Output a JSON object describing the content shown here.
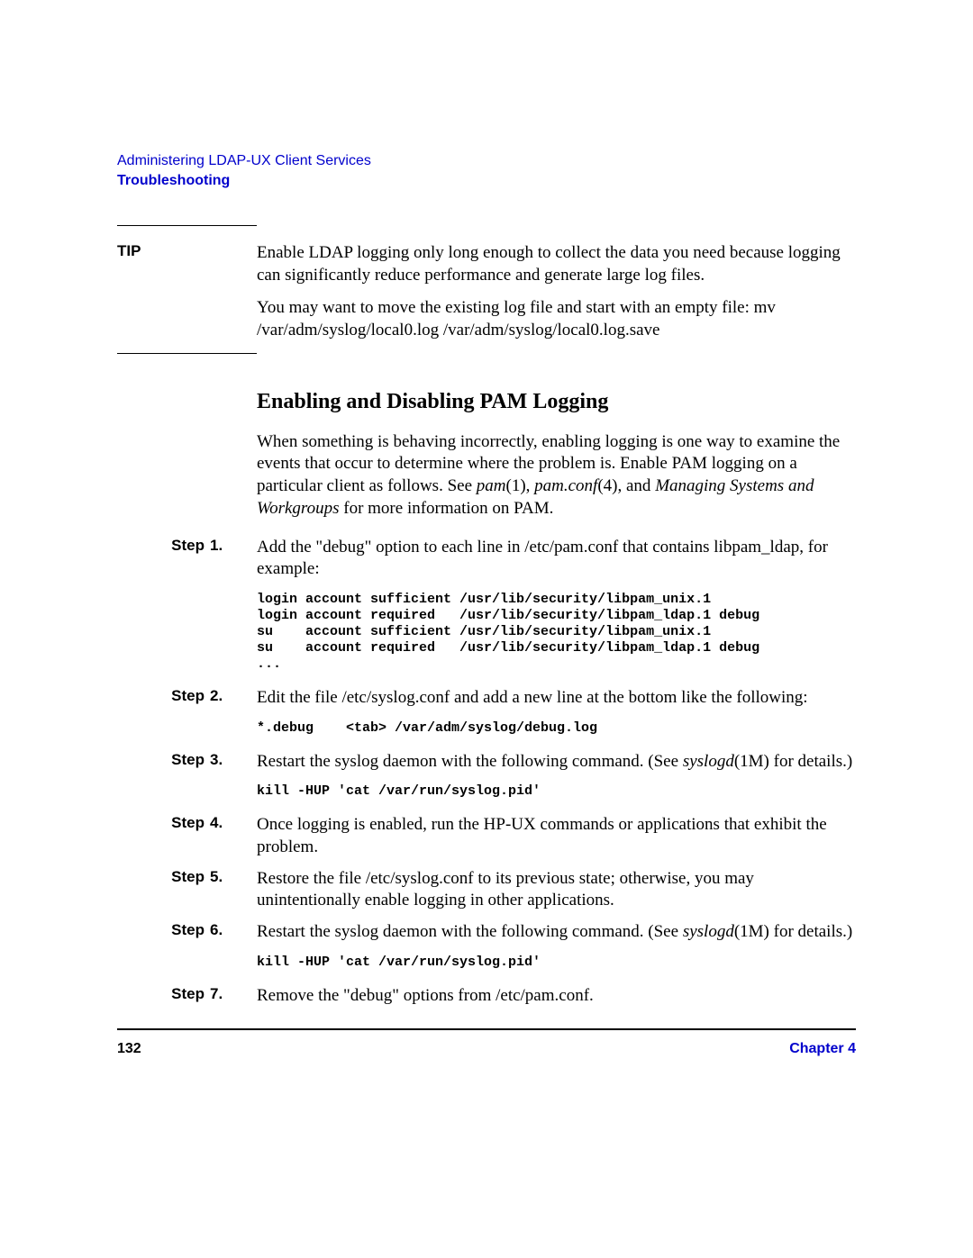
{
  "header": {
    "breadcrumb": "Administering LDAP-UX Client Services",
    "section": "Troubleshooting"
  },
  "tip": {
    "label": "TIP",
    "para1": "Enable LDAP logging only long enough to collect the data you need because logging can significantly reduce performance and generate large log files.",
    "para2": "You may want to move the existing log file and start with an empty file: mv /var/adm/syslog/local0.log /var/adm/syslog/local0.log.save"
  },
  "heading": "Enabling and Disabling PAM Logging",
  "intro": {
    "prefix": "When something is behaving incorrectly, enabling logging is one way to examine the events that occur to determine where the problem is. Enable PAM logging on a particular client as follows. See ",
    "ital1": "pam",
    "mid1": "(1), ",
    "ital2": "pam.conf",
    "mid2": "(4), and ",
    "ital3": "Managing Systems and Workgroups",
    "suffix": " for more information on PAM."
  },
  "steps": {
    "label": "Step",
    "s1": {
      "num": "1.",
      "text": "Add the \"debug\" option to each line in /etc/pam.conf that contains libpam_ldap, for example:",
      "code": "login account sufficient /usr/lib/security/libpam_unix.1\nlogin account required   /usr/lib/security/libpam_ldap.1 debug\nsu    account sufficient /usr/lib/security/libpam_unix.1\nsu    account required   /usr/lib/security/libpam_ldap.1 debug\n..."
    },
    "s2": {
      "num": "2.",
      "text": "Edit the file /etc/syslog.conf and add a new line at the bottom like the following:",
      "code": "*.debug    <tab> /var/adm/syslog/debug.log"
    },
    "s3": {
      "num": "3.",
      "prefix": "Restart the syslog daemon with the following command. (See ",
      "ital": "syslogd",
      "suffix": "(1M) for details.)",
      "code": "kill -HUP 'cat /var/run/syslog.pid'"
    },
    "s4": {
      "num": "4.",
      "text": "Once logging is enabled, run the HP-UX commands or applications that exhibit the problem."
    },
    "s5": {
      "num": "5.",
      "text": "Restore the file /etc/syslog.conf to its previous state; otherwise, you may unintentionally enable logging in other applications."
    },
    "s6": {
      "num": "6.",
      "prefix": "Restart the syslog daemon with the following command. (See ",
      "ital": "syslogd",
      "suffix": "(1M) for details.)",
      "code": "kill -HUP 'cat /var/run/syslog.pid'"
    },
    "s7": {
      "num": "7.",
      "text": "Remove the \"debug\" options from /etc/pam.conf."
    }
  },
  "footer": {
    "page": "132",
    "chapter": "Chapter 4"
  }
}
